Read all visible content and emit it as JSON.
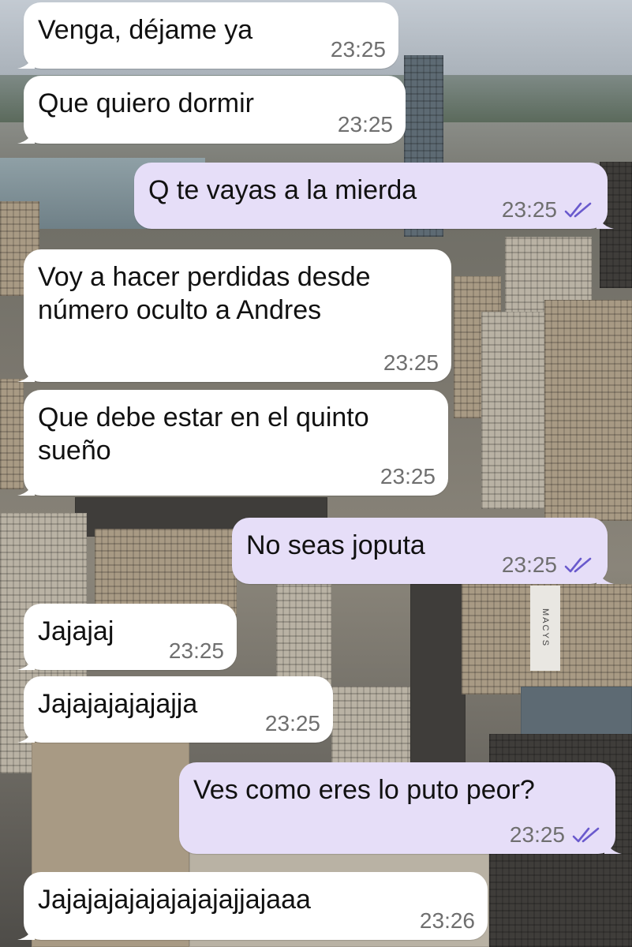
{
  "chat": {
    "messages": [
      {
        "direction": "incoming",
        "text": "Venga, déjame ya",
        "time": "23:25"
      },
      {
        "direction": "incoming",
        "text": "Que quiero dormir",
        "time": "23:25"
      },
      {
        "direction": "outgoing",
        "text": "Q te vayas a la mierda",
        "time": "23:25",
        "status": "read"
      },
      {
        "direction": "incoming",
        "text": "Voy a hacer perdidas desde\nnúmero oculto a Andres",
        "time": "23:25"
      },
      {
        "direction": "incoming",
        "text": "Que debe estar en el quinto\nsueño",
        "time": "23:25"
      },
      {
        "direction": "outgoing",
        "text": "No seas joputa",
        "time": "23:25",
        "status": "read"
      },
      {
        "direction": "incoming",
        "text": "Jajajaj",
        "time": "23:25"
      },
      {
        "direction": "incoming",
        "text": "Jajajajajajajja",
        "time": "23:25"
      },
      {
        "direction": "outgoing",
        "text": "Ves como eres lo puto peor?",
        "time": "23:25",
        "status": "read"
      },
      {
        "direction": "incoming",
        "text": "Jajajajajajajajajajjajaaa",
        "time": "23:26"
      }
    ]
  },
  "background": {
    "scene": "city-skyline-photo",
    "sign_text": "MACYS"
  },
  "colors": {
    "incoming_bubble": "#ffffff",
    "outgoing_bubble": "#e6def8",
    "read_tick": "#6a5acd",
    "time_text": "#6f6f6f"
  },
  "icons": {
    "read_receipt": "double-check-icon"
  }
}
